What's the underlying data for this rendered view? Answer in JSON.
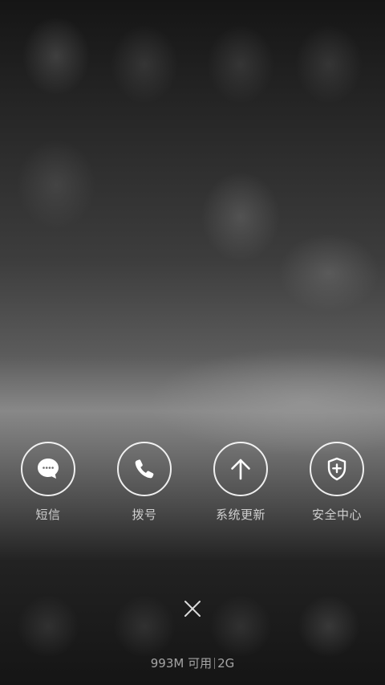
{
  "shortcuts": [
    {
      "label": "短信",
      "icon": "message-icon"
    },
    {
      "label": "拨号",
      "icon": "phone-icon"
    },
    {
      "label": "系统更新",
      "icon": "arrow-up-icon"
    },
    {
      "label": "安全中心",
      "icon": "shield-plus-icon"
    }
  ],
  "close": {
    "icon": "close-icon"
  },
  "status": {
    "memory": "993M 可用",
    "network": "2G"
  },
  "colors": {
    "icon_stroke": "#ffffff",
    "label_text": "#e6e6e6",
    "status_text": "#c8c8c8"
  }
}
